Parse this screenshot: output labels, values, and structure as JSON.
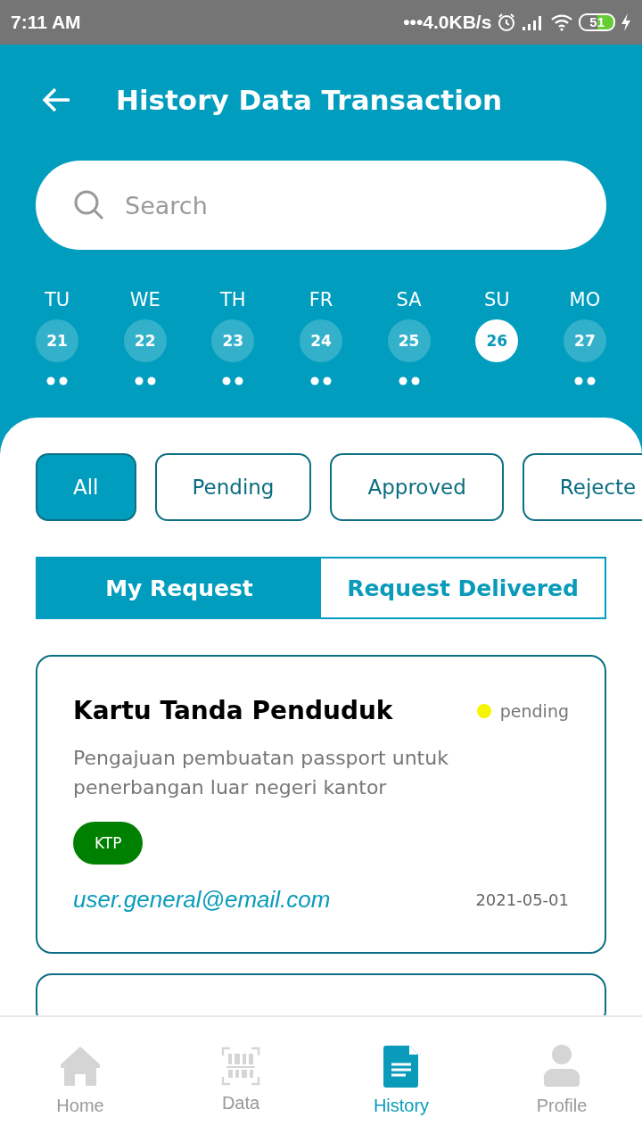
{
  "status_bar": {
    "time": "7:11 AM",
    "speed": "•••4.0KB/s",
    "battery": "51"
  },
  "header": {
    "title": "History Data Transaction"
  },
  "search": {
    "placeholder": "Search"
  },
  "days": [
    {
      "weekday": "TU",
      "date": "21",
      "selected": false,
      "has_events": true
    },
    {
      "weekday": "WE",
      "date": "22",
      "selected": false,
      "has_events": true
    },
    {
      "weekday": "TH",
      "date": "23",
      "selected": false,
      "has_events": true
    },
    {
      "weekday": "FR",
      "date": "24",
      "selected": false,
      "has_events": true
    },
    {
      "weekday": "SA",
      "date": "25",
      "selected": false,
      "has_events": true
    },
    {
      "weekday": "SU",
      "date": "26",
      "selected": true,
      "has_events": false
    },
    {
      "weekday": "MO",
      "date": "27",
      "selected": false,
      "has_events": true
    }
  ],
  "filters": [
    {
      "label": "All",
      "selected": true
    },
    {
      "label": "Pending",
      "selected": false
    },
    {
      "label": "Approved",
      "selected": false
    },
    {
      "label": "Rejecte",
      "selected": false
    }
  ],
  "tabs": [
    {
      "label": "My Request",
      "selected": true
    },
    {
      "label": "Request Delivered",
      "selected": false
    }
  ],
  "cards": [
    {
      "title": "Kartu Tanda Penduduk",
      "status": "pending",
      "color": "#f5f500",
      "description": "Pengajuan pembuatan passport untuk penerbangan luar negeri kantor",
      "tag": "KTP",
      "email": "user.general@email.com",
      "date": "2021-05-01"
    }
  ],
  "nav": [
    {
      "label": "Home",
      "kind": "home",
      "selected": false
    },
    {
      "label": "Data",
      "kind": "scan",
      "selected": false
    },
    {
      "label": "History",
      "kind": "document",
      "selected": true
    },
    {
      "label": "Profile",
      "kind": "profile",
      "selected": false
    }
  ]
}
